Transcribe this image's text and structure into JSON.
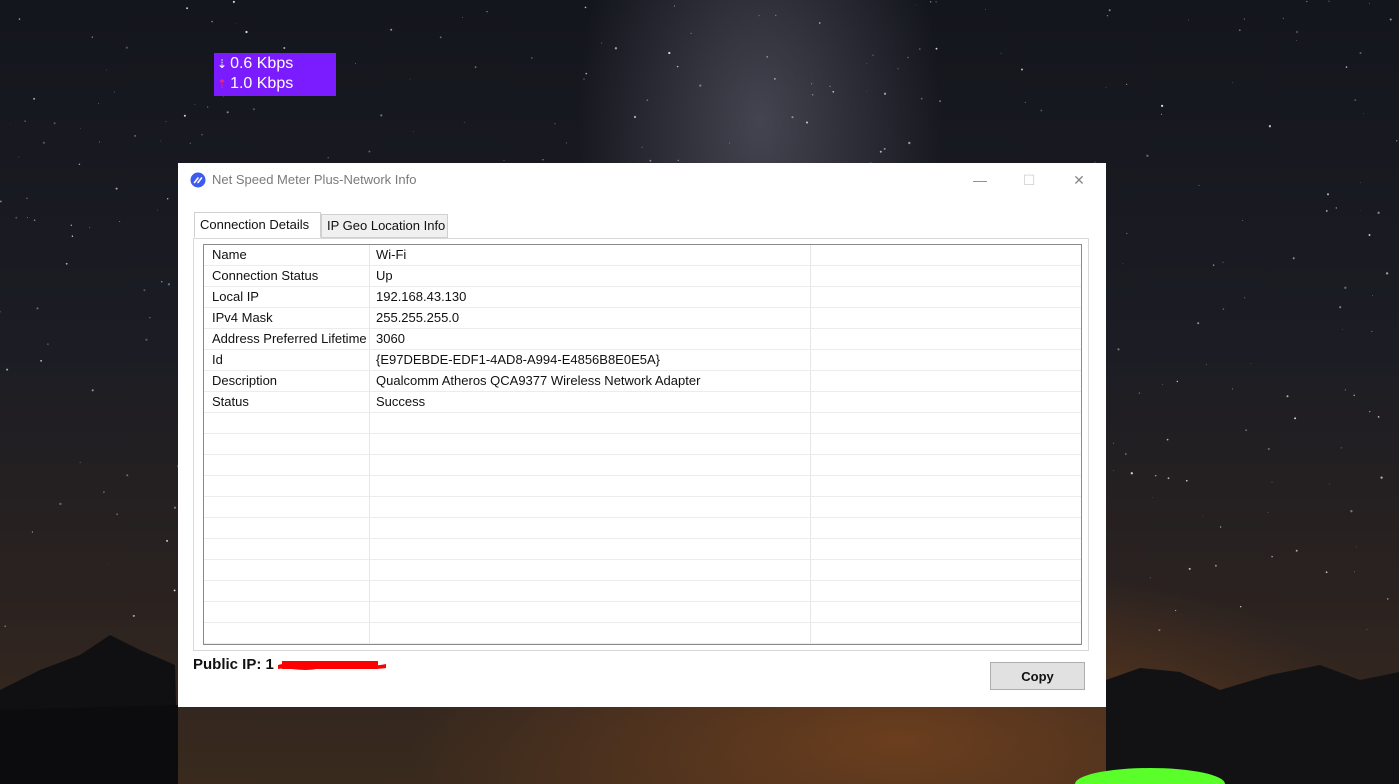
{
  "speed_widget": {
    "download": "0.6 Kbps",
    "upload": "1.0 Kbps",
    "download_arrow": "⇣",
    "upload_arrow": "⇡"
  },
  "window": {
    "title": "Net Speed Meter Plus-Network Info",
    "minimize": "—",
    "maximize": "☐",
    "close": "✕"
  },
  "tabs": [
    {
      "label": "Connection Details",
      "active": true
    },
    {
      "label": "IP Geo Location Info",
      "active": false
    }
  ],
  "connection_details": {
    "rows": [
      {
        "field": "Name",
        "value": "Wi-Fi",
        "extra": ""
      },
      {
        "field": "Connection Status",
        "value": "Up",
        "extra": ""
      },
      {
        "field": "Local IP",
        "value": "192.168.43.130",
        "extra": ""
      },
      {
        "field": "IPv4 Mask",
        "value": "255.255.255.0",
        "extra": ""
      },
      {
        "field": "Address Preferred Lifetime",
        "value": "3060",
        "extra": ""
      },
      {
        "field": "Id",
        "value": "{E97DEBDE-EDF1-4AD8-A994-E4856B8E0E5A}",
        "extra": ""
      },
      {
        "field": "Description",
        "value": "Qualcomm Atheros QCA9377 Wireless Network Adapter",
        "extra": ""
      },
      {
        "field": "Status",
        "value": "Success",
        "extra": ""
      }
    ]
  },
  "footer": {
    "public_ip_label": "Public IP:",
    "public_ip_prefix": "1",
    "copy_button": "Copy"
  },
  "colors": {
    "widget_bg": "#7a1cff",
    "redaction": "#ff0000"
  }
}
